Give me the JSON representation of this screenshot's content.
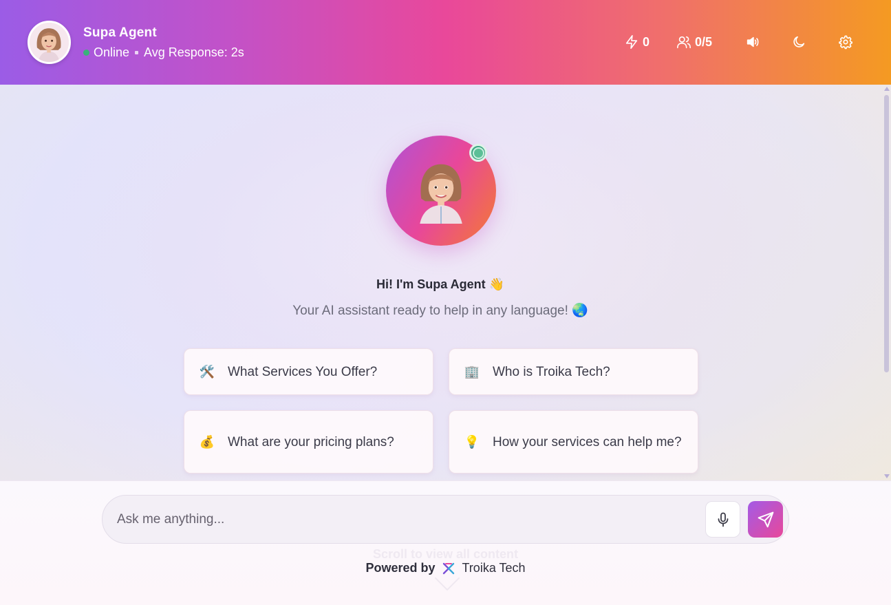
{
  "header": {
    "agent_name": "Supa Agent",
    "status": "Online",
    "avg_response": "Avg Response: 2s",
    "stats": {
      "energy_count": "0",
      "users_count": "0/5"
    },
    "icons": [
      "lightning-icon",
      "users-icon",
      "volume-icon",
      "moon-icon",
      "gear-icon"
    ]
  },
  "hero": {
    "greeting": "Hi! I'm Supa Agent 👋",
    "subtitle": "Your AI assistant ready to help in any language! 🌏"
  },
  "suggestions": [
    {
      "emoji": "🛠️",
      "label": "What Services You Offer?"
    },
    {
      "emoji": "🏢",
      "label": "Who is Troika Tech?"
    },
    {
      "emoji": "💰",
      "label": "What are your pricing plans?"
    },
    {
      "emoji": "💡",
      "label": "How your services can help me?"
    }
  ],
  "composer": {
    "placeholder": "Ask me anything..."
  },
  "footer": {
    "scroll_hint": "Scroll to view all content",
    "powered_by": "Powered by",
    "brand": "Troika Tech"
  },
  "colors": {
    "header_gradient_start": "#9b5ce6",
    "header_gradient_mid": "#e9489a",
    "header_gradient_end": "#f49a22",
    "online": "#3bb27a"
  }
}
